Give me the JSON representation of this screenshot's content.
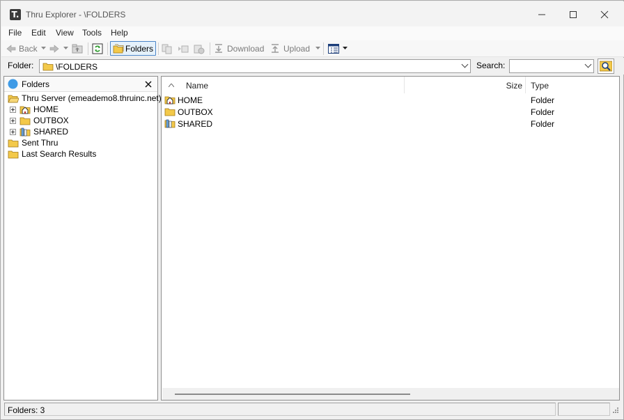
{
  "window": {
    "title": "Thru Explorer - \\FOLDERS",
    "app_icon_letter": "T."
  },
  "menu": [
    "File",
    "Edit",
    "View",
    "Tools",
    "Help"
  ],
  "toolbar": {
    "back_label": "Back",
    "folders_label": "Folders",
    "download_label": "Download",
    "upload_label": "Upload"
  },
  "address": {
    "folder_label": "Folder:",
    "folder_value": "\\FOLDERS",
    "search_label": "Search:",
    "search_value": ""
  },
  "tree": {
    "header": "Folders",
    "root": "Thru Server (emeademo8.thruinc.net)",
    "children": [
      "HOME",
      "OUTBOX",
      "SHARED"
    ],
    "sent": "Sent Thru",
    "last_search": "Last Search Results"
  },
  "list": {
    "columns": {
      "name": "Name",
      "size": "Size",
      "type": "Type"
    },
    "rows": [
      {
        "name": "HOME",
        "size": "",
        "type": "Folder",
        "icon": "home-folder-icon"
      },
      {
        "name": "OUTBOX",
        "size": "",
        "type": "Folder",
        "icon": "folder-icon"
      },
      {
        "name": "SHARED",
        "size": "",
        "type": "Folder",
        "icon": "shared-folder-icon"
      }
    ]
  },
  "status": {
    "folders_count": "Folders: 3"
  },
  "colors": {
    "accent": "#4b85c7",
    "folder_yellow": "#f3c94a",
    "tree_root_icon": "#3f9be6"
  }
}
